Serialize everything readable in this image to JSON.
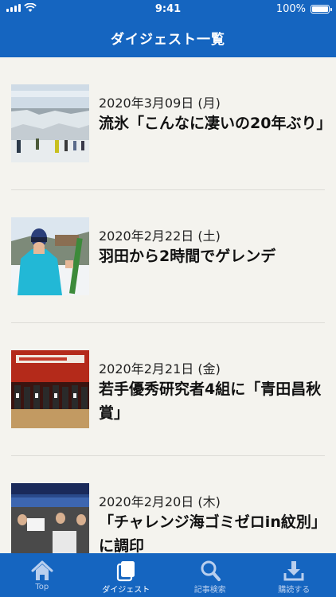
{
  "status_bar": {
    "time": "9:41",
    "battery": "100%",
    "battery_level": 1.0
  },
  "header": {
    "title": "ダイジェスト一覧"
  },
  "articles": [
    {
      "date": "2020年3月09日 (月)",
      "title": "流氷「こんなに凄いの20年ぶり」",
      "thumb_icon": "drift-ice-photo"
    },
    {
      "date": "2020年2月22日 (土)",
      "title": "羽田から2時間でゲレンデ",
      "thumb_icon": "skier-photo"
    },
    {
      "date": "2020年2月21日 (金)",
      "title": "若手優秀研究者4組に「青田昌秋賞」",
      "thumb_icon": "award-ceremony-photo"
    },
    {
      "date": "2020年2月20日 (木)",
      "title": "「チャレンジ海ゴミゼロin紋別」に調印",
      "thumb_icon": "symposium-photo"
    }
  ],
  "tabs": [
    {
      "label": "Top",
      "icon": "home-icon",
      "active": false
    },
    {
      "label": "ダイジェスト",
      "icon": "digest-icon",
      "active": true
    },
    {
      "label": "記事検索",
      "icon": "search-icon",
      "active": false
    },
    {
      "label": "購読する",
      "icon": "download-icon",
      "active": false
    }
  ],
  "colors": {
    "accent": "#1565c0",
    "background": "#f4f3ee",
    "tab_inactive": "#b9cfee"
  }
}
